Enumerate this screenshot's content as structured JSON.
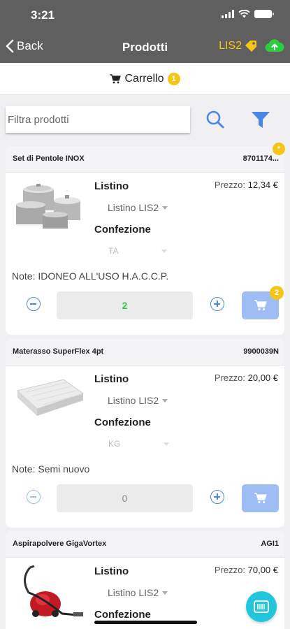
{
  "status": {
    "time": "3:21"
  },
  "nav": {
    "back_label": "Back",
    "title": "Prodotti",
    "listino": "LIS2"
  },
  "cart": {
    "label": "Carrello",
    "count": "1"
  },
  "search": {
    "placeholder": "Filtra prodotti"
  },
  "products": [
    {
      "name": "Set di Pentole INOX",
      "code": "8701174...",
      "code_badge": "*",
      "listino_label": "Listino",
      "price_label": "Prezzo:",
      "price": "12,34 €",
      "listino_value": "Listino LIS2",
      "confezione_label": "Confezione",
      "confezione_value": "TA",
      "note": "Note: IDONEO ALL'USO H.A.C.C.P.",
      "quantity": "2",
      "cart_count": "2",
      "image": "pots-image"
    },
    {
      "name": "Materasso SuperFlex 4pt",
      "code": "9900039N",
      "listino_label": "Listino",
      "price_label": "Prezzo:",
      "price": "20,00 €",
      "listino_value": "Listino LIS2",
      "confezione_label": "Confezione",
      "confezione_value": "KG",
      "note": "Note: Semi nuovo",
      "quantity": "0",
      "image": "mattress-image"
    },
    {
      "name": "Aspirapolvere GigaVortex",
      "code": "AGI1",
      "listino_label": "Listino",
      "price_label": "Prezzo:",
      "price": "70,00 €",
      "listino_value": "Listino LIS2",
      "confezione_label": "Confezione",
      "image": "vacuum-image"
    }
  ],
  "colors": {
    "navbar": "#5f5f5f",
    "accent_blue": "#4a86e8",
    "badge_yellow": "#f5c518",
    "qty_green": "#2ecc40",
    "fab": "#22c6dc"
  },
  "icons": {
    "back": "chevron-left-icon",
    "tag": "tag-icon",
    "upload": "cloud-upload-icon",
    "cart": "cart-icon",
    "search": "search-icon",
    "filter": "filter-icon",
    "barcode": "barcode-icon"
  }
}
